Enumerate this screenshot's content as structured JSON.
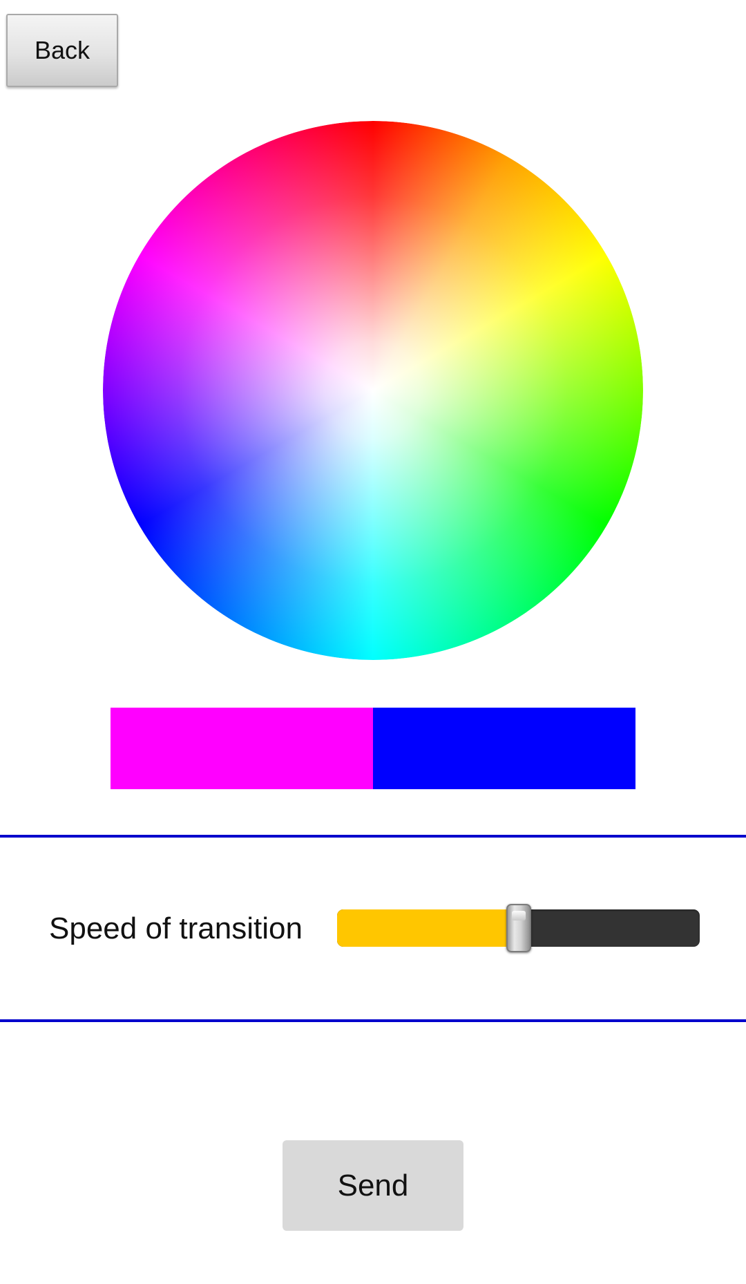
{
  "header": {
    "back_label": "Back"
  },
  "color_picker": {
    "icon": "hsv-color-wheel",
    "hue_stops": [
      "#ff0000",
      "#ffa000",
      "#ffff00",
      "#80ff00",
      "#00ff00",
      "#00ff80",
      "#00ffff",
      "#0080ff",
      "#0000ff",
      "#8000ff",
      "#ff00ff",
      "#ff0080",
      "#ff0000"
    ],
    "center_color": "#ffffff"
  },
  "selected_colors": {
    "first": "#ff00ff",
    "second": "#0000ff"
  },
  "divider_color": "#0000cc",
  "speed": {
    "label": "Speed of transition",
    "value_fraction": 0.5,
    "fill_color": "#ffc600",
    "track_color": "#333333"
  },
  "footer": {
    "send_label": "Send"
  }
}
